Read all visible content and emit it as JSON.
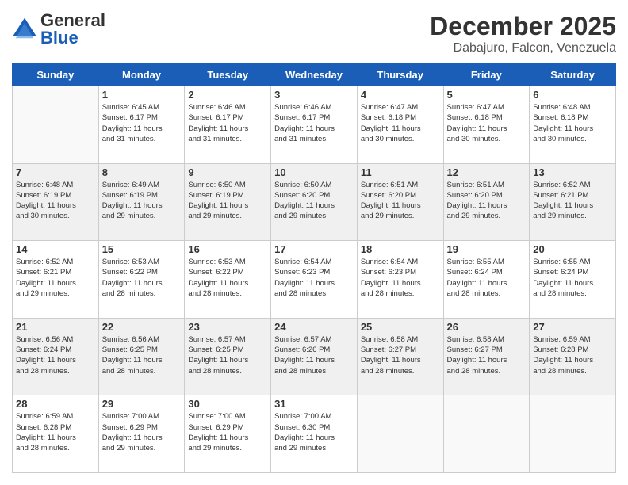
{
  "header": {
    "logo_general": "General",
    "logo_blue": "Blue",
    "month_title": "December 2025",
    "location": "Dabajuro, Falcon, Venezuela"
  },
  "weekdays": [
    "Sunday",
    "Monday",
    "Tuesday",
    "Wednesday",
    "Thursday",
    "Friday",
    "Saturday"
  ],
  "weeks": [
    [
      {
        "day": "",
        "info": ""
      },
      {
        "day": "1",
        "info": "Sunrise: 6:45 AM\nSunset: 6:17 PM\nDaylight: 11 hours\nand 31 minutes."
      },
      {
        "day": "2",
        "info": "Sunrise: 6:46 AM\nSunset: 6:17 PM\nDaylight: 11 hours\nand 31 minutes."
      },
      {
        "day": "3",
        "info": "Sunrise: 6:46 AM\nSunset: 6:17 PM\nDaylight: 11 hours\nand 31 minutes."
      },
      {
        "day": "4",
        "info": "Sunrise: 6:47 AM\nSunset: 6:18 PM\nDaylight: 11 hours\nand 30 minutes."
      },
      {
        "day": "5",
        "info": "Sunrise: 6:47 AM\nSunset: 6:18 PM\nDaylight: 11 hours\nand 30 minutes."
      },
      {
        "day": "6",
        "info": "Sunrise: 6:48 AM\nSunset: 6:18 PM\nDaylight: 11 hours\nand 30 minutes."
      }
    ],
    [
      {
        "day": "7",
        "info": "Sunrise: 6:48 AM\nSunset: 6:19 PM\nDaylight: 11 hours\nand 30 minutes."
      },
      {
        "day": "8",
        "info": "Sunrise: 6:49 AM\nSunset: 6:19 PM\nDaylight: 11 hours\nand 29 minutes."
      },
      {
        "day": "9",
        "info": "Sunrise: 6:50 AM\nSunset: 6:19 PM\nDaylight: 11 hours\nand 29 minutes."
      },
      {
        "day": "10",
        "info": "Sunrise: 6:50 AM\nSunset: 6:20 PM\nDaylight: 11 hours\nand 29 minutes."
      },
      {
        "day": "11",
        "info": "Sunrise: 6:51 AM\nSunset: 6:20 PM\nDaylight: 11 hours\nand 29 minutes."
      },
      {
        "day": "12",
        "info": "Sunrise: 6:51 AM\nSunset: 6:20 PM\nDaylight: 11 hours\nand 29 minutes."
      },
      {
        "day": "13",
        "info": "Sunrise: 6:52 AM\nSunset: 6:21 PM\nDaylight: 11 hours\nand 29 minutes."
      }
    ],
    [
      {
        "day": "14",
        "info": "Sunrise: 6:52 AM\nSunset: 6:21 PM\nDaylight: 11 hours\nand 29 minutes."
      },
      {
        "day": "15",
        "info": "Sunrise: 6:53 AM\nSunset: 6:22 PM\nDaylight: 11 hours\nand 28 minutes."
      },
      {
        "day": "16",
        "info": "Sunrise: 6:53 AM\nSunset: 6:22 PM\nDaylight: 11 hours\nand 28 minutes."
      },
      {
        "day": "17",
        "info": "Sunrise: 6:54 AM\nSunset: 6:23 PM\nDaylight: 11 hours\nand 28 minutes."
      },
      {
        "day": "18",
        "info": "Sunrise: 6:54 AM\nSunset: 6:23 PM\nDaylight: 11 hours\nand 28 minutes."
      },
      {
        "day": "19",
        "info": "Sunrise: 6:55 AM\nSunset: 6:24 PM\nDaylight: 11 hours\nand 28 minutes."
      },
      {
        "day": "20",
        "info": "Sunrise: 6:55 AM\nSunset: 6:24 PM\nDaylight: 11 hours\nand 28 minutes."
      }
    ],
    [
      {
        "day": "21",
        "info": "Sunrise: 6:56 AM\nSunset: 6:24 PM\nDaylight: 11 hours\nand 28 minutes."
      },
      {
        "day": "22",
        "info": "Sunrise: 6:56 AM\nSunset: 6:25 PM\nDaylight: 11 hours\nand 28 minutes."
      },
      {
        "day": "23",
        "info": "Sunrise: 6:57 AM\nSunset: 6:25 PM\nDaylight: 11 hours\nand 28 minutes."
      },
      {
        "day": "24",
        "info": "Sunrise: 6:57 AM\nSunset: 6:26 PM\nDaylight: 11 hours\nand 28 minutes."
      },
      {
        "day": "25",
        "info": "Sunrise: 6:58 AM\nSunset: 6:27 PM\nDaylight: 11 hours\nand 28 minutes."
      },
      {
        "day": "26",
        "info": "Sunrise: 6:58 AM\nSunset: 6:27 PM\nDaylight: 11 hours\nand 28 minutes."
      },
      {
        "day": "27",
        "info": "Sunrise: 6:59 AM\nSunset: 6:28 PM\nDaylight: 11 hours\nand 28 minutes."
      }
    ],
    [
      {
        "day": "28",
        "info": "Sunrise: 6:59 AM\nSunset: 6:28 PM\nDaylight: 11 hours\nand 28 minutes."
      },
      {
        "day": "29",
        "info": "Sunrise: 7:00 AM\nSunset: 6:29 PM\nDaylight: 11 hours\nand 29 minutes."
      },
      {
        "day": "30",
        "info": "Sunrise: 7:00 AM\nSunset: 6:29 PM\nDaylight: 11 hours\nand 29 minutes."
      },
      {
        "day": "31",
        "info": "Sunrise: 7:00 AM\nSunset: 6:30 PM\nDaylight: 11 hours\nand 29 minutes."
      },
      {
        "day": "",
        "info": ""
      },
      {
        "day": "",
        "info": ""
      },
      {
        "day": "",
        "info": ""
      }
    ]
  ]
}
